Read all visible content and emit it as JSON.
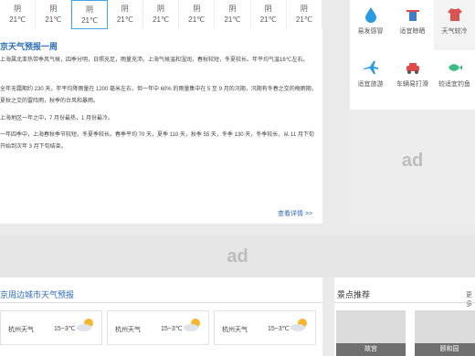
{
  "days": [
    {
      "weather": "阴",
      "temp": "21℃"
    },
    {
      "weather": "阴",
      "temp": "21℃"
    },
    {
      "weather": "阴",
      "temp": "21℃"
    },
    {
      "weather": "阴",
      "temp": "21℃"
    },
    {
      "weather": "阴",
      "temp": "21℃"
    },
    {
      "weather": "阴",
      "temp": "21℃"
    },
    {
      "weather": "阴",
      "temp": "21℃"
    },
    {
      "weather": "阴",
      "temp": "21℃"
    },
    {
      "weather": "阴",
      "temp": "21℃"
    }
  ],
  "forecast": {
    "title": "京天气预报一周",
    "paragraphs": [
      "上海属北亚热带季风气候，四季分明，日照充足，雨量充沛。上海气候温和湿润，春秋较短，冬夏较长。年平均气温16℃左右。",
      "全年无霜期约 230 天，年平均降雨量在 1200 毫米左右，但一年中 60% 的雨量集中在 5 至 9 月的汛期，汛期有冬春之交的梅雨期，夏秋之交的雷阵雨，秋季的台风和暴雨。",
      "上海地区一年之中，7 月份最热，1 月份最冷。",
      "一年四季中，上海春秋季节较短，冬夏季较长。春季平均 70 天，夏季 110 天，秋季 55 天，冬季 130 天，冬季较长，从 11 月下旬开始到次年 3 月下旬结束。"
    ],
    "more": "查看详情 >>"
  },
  "life_icons": [
    {
      "name": "hair-icon",
      "label": "易发感冒",
      "color": "#2a9be0"
    },
    {
      "name": "clothes-icon",
      "label": "适宜晾晒",
      "color": "#e24a4a"
    },
    {
      "name": "shirt-icon",
      "label": "天气较冷",
      "color": "#3d7fc7"
    },
    {
      "name": "plane-icon",
      "label": "适宜旅游",
      "color": "#2a9be0"
    },
    {
      "name": "car-icon",
      "label": "车辆易打滑",
      "color": "#e24a4a"
    },
    {
      "name": "fish-icon",
      "label": "较适宜钓鱼",
      "color": "#3dbb84"
    }
  ],
  "ads": {
    "right": "ad",
    "middle": "ad"
  },
  "around": {
    "title": "京周边城市天气预报",
    "cities": [
      {
        "name": "杭州天气",
        "temp": "15~3℃"
      },
      {
        "name": "杭州天气",
        "temp": "15~3℃"
      },
      {
        "name": "杭州天气",
        "temp": "15~3℃"
      }
    ]
  },
  "scenic": {
    "title": "景点推荐",
    "more": "更多",
    "items": [
      {
        "label": "故宫"
      },
      {
        "label": "颐和园"
      }
    ]
  }
}
